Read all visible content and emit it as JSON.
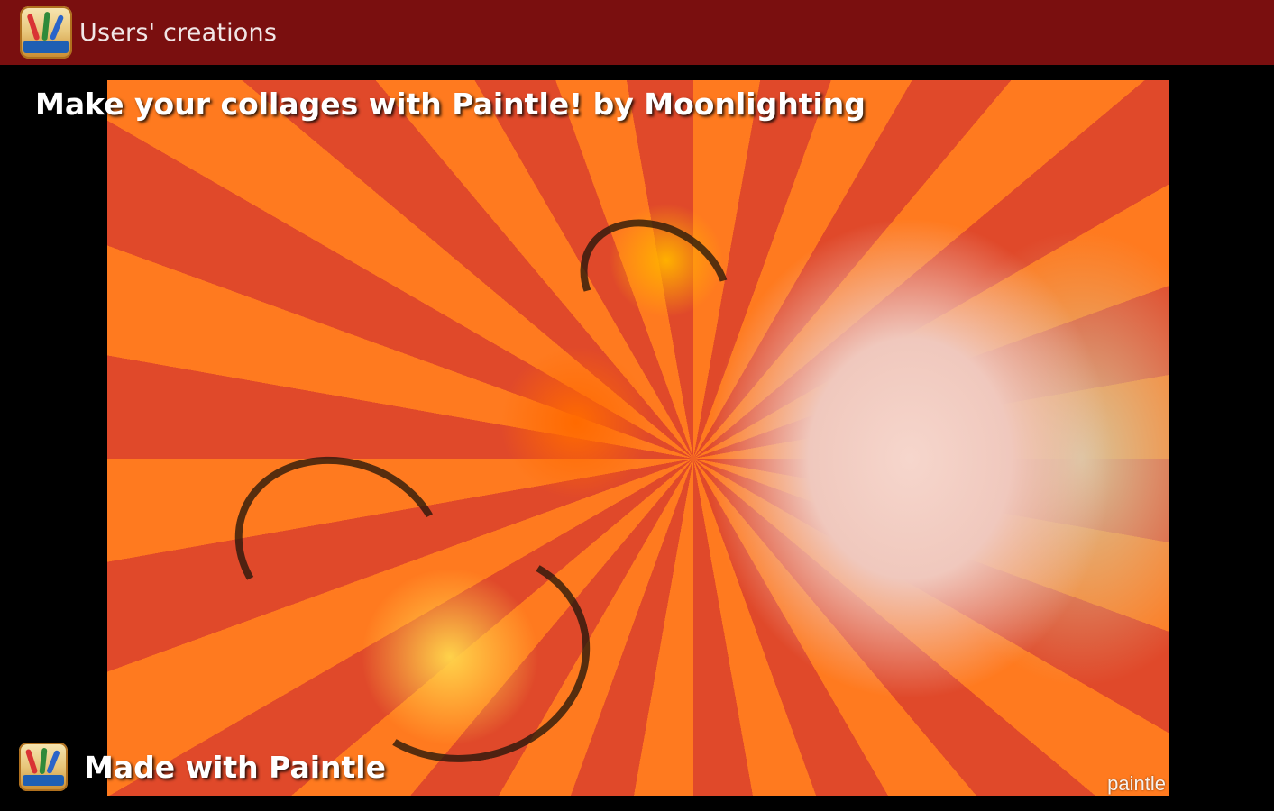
{
  "action_bar": {
    "title": "Users' creations",
    "icon": "paintle-app-icon",
    "background": "#7a0f0f"
  },
  "viewer": {
    "caption": "Make your collages with Paintle! by Moonlighting",
    "watermark": "paintle",
    "footer": {
      "icon": "paintle-app-icon",
      "label": "Made with Paintle"
    }
  }
}
